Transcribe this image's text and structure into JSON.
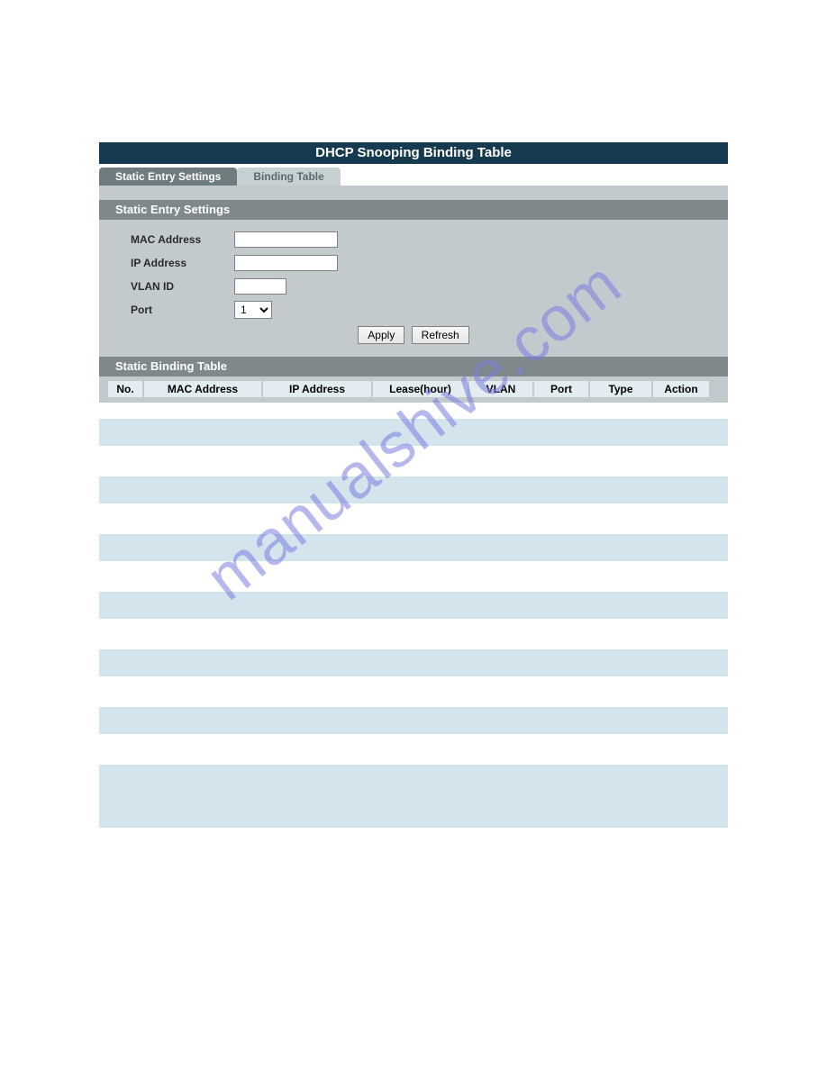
{
  "title": "DHCP Snooping Binding Table",
  "tabs": {
    "static_entry": "Static Entry Settings",
    "binding_table": "Binding Table"
  },
  "sections": {
    "static_entry_settings": "Static Entry Settings",
    "static_binding_table": "Static Binding Table"
  },
  "form": {
    "mac_label": "MAC Address",
    "mac_value": "",
    "ip_label": "IP Address",
    "ip_value": "",
    "vlan_label": "VLAN ID",
    "vlan_value": "",
    "port_label": "Port",
    "port_value": "1"
  },
  "buttons": {
    "apply": "Apply",
    "refresh": "Refresh"
  },
  "table_headers": {
    "no": "No.",
    "mac": "MAC Address",
    "ip": "IP Address",
    "lease": "Lease(hour)",
    "vlan": "VLAN",
    "port": "Port",
    "type": "Type",
    "action": "Action"
  },
  "watermark": "manualshive.com"
}
